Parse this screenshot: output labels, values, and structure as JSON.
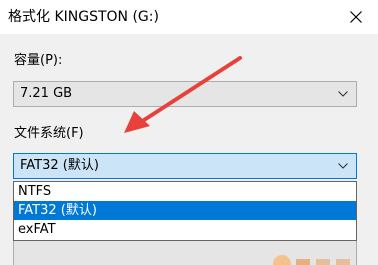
{
  "window": {
    "title": "格式化 KINGSTON (G:)",
    "close_icon": "close-icon"
  },
  "capacity": {
    "label": "容量(P):",
    "value": "7.21 GB"
  },
  "filesystem": {
    "label": "文件系统(F)",
    "value": "FAT32 (默认)",
    "options": [
      "NTFS",
      "FAT32 (默认)",
      "exFAT"
    ],
    "selected_index": 1
  },
  "colors": {
    "accent": "#0078d7",
    "arrow": "#e8413c"
  }
}
